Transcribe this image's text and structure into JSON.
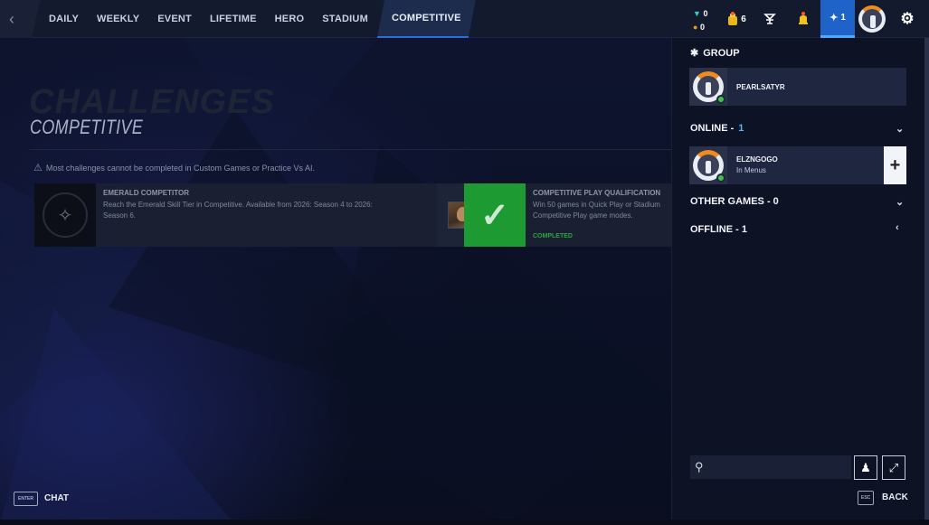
{
  "colors": {
    "accent": "#1f63c9",
    "online": "#40c24a",
    "completed": "#2aa63e",
    "count_blue": "#4fb6ff"
  },
  "nav": {
    "back_icon": "chevron-left-icon",
    "tabs": [
      {
        "label": "DAILY"
      },
      {
        "label": "WEEKLY"
      },
      {
        "label": "EVENT"
      },
      {
        "label": "LIFETIME"
      },
      {
        "label": "HERO"
      },
      {
        "label": "STADIUM"
      },
      {
        "label": "COMPETITIVE",
        "active": true
      }
    ]
  },
  "topbar": {
    "legacy_credits": "0",
    "credits": "0",
    "loot": "6",
    "friends_count": "1",
    "icons": [
      "diamond-icon",
      "coin-icon",
      "lootbox-icon",
      "trophy-icon",
      "bell-icon",
      "friends-icon",
      "avatar",
      "gear-icon"
    ]
  },
  "page": {
    "ghost_title": "CHALLENGES",
    "section_title": "COMPETITIVE",
    "warning": "Most challenges cannot be completed in Custom Games or Practice Vs AI."
  },
  "challenges": [
    {
      "title": "EMERALD COMPETITOR",
      "desc": "Reach the Emerald Skill Tier in Competitive. Available from 2026: Season 4 to 2026: Season 6.",
      "icon": "emerald-rank-icon"
    },
    {
      "title": "COMPETITIVE PLAY QUALIFICATION",
      "desc": "Win 50 games in Quick Play or Stadium Competitive Play game modes.",
      "status": "COMPLETED",
      "icon": "checkmark-icon"
    }
  ],
  "footer": {
    "chat_key": "ENTER",
    "chat_label": "CHAT",
    "esc_key": "ESC",
    "back_label": "BACK"
  },
  "social": {
    "group": {
      "label": "GROUP",
      "member": "PEARLSATYR"
    },
    "online": {
      "label": "ONLINE - ",
      "count": "1",
      "friend_name": "ELZNGOGO",
      "friend_status": "In Menus"
    },
    "other_games": {
      "label": "OTHER GAMES - 0"
    },
    "offline": {
      "label": "OFFLINE - 1"
    },
    "search": {
      "placeholder": ""
    }
  }
}
